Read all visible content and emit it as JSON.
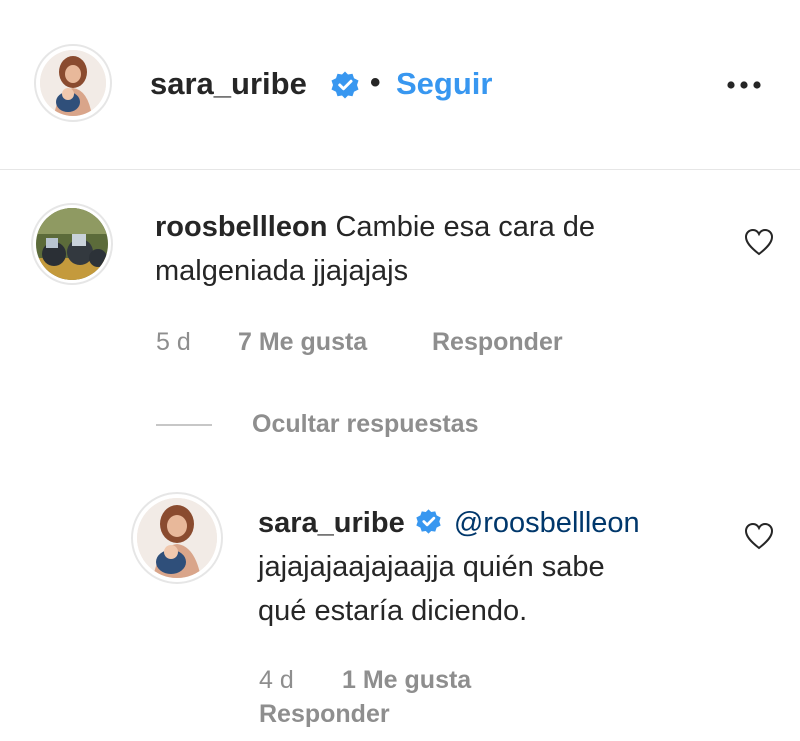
{
  "colors": {
    "accent": "#3897f0",
    "text": "#262626",
    "muted": "#8e8e8e",
    "mention": "#00376b",
    "divider": "#e6e6e6"
  },
  "header": {
    "username": "sara_uribe",
    "separator": "•",
    "follow_label": "Seguir",
    "more_icon": "more-options-icon"
  },
  "comments": [
    {
      "username": "roosbellleon",
      "text_line1": "Cambie esa cara de",
      "text_line2": "malgeniada jjajajajs",
      "time": "5 d",
      "likes": "7 Me gusta",
      "reply_label": "Responder"
    }
  ],
  "replies_toggle": "Ocultar respuestas",
  "reply": {
    "username": "sara_uribe",
    "mention": "@roosbellleon",
    "text_line1": "jajajajaajajaajja quién sabe",
    "text_line2": "qué estaría diciendo.",
    "time": "4 d",
    "likes": "1 Me gusta",
    "reply_label": "Responder"
  }
}
